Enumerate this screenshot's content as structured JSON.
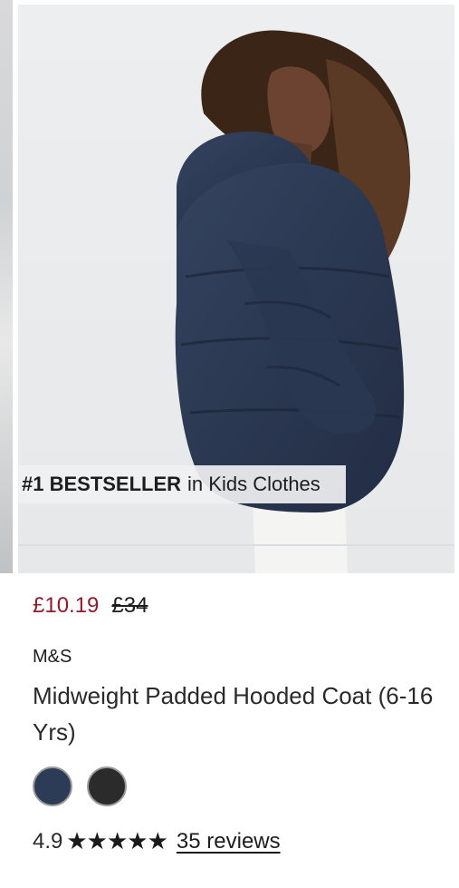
{
  "badge": {
    "rank": "#1 BESTSELLER",
    "category": "in Kids Clothes"
  },
  "price": {
    "current": "£10.19",
    "original": "£34"
  },
  "product": {
    "brand": "M&S",
    "title": "Midweight Padded Hooded Coat (6-16 Yrs)",
    "image_alt": "Girl wearing navy padded hooded coat",
    "colors": [
      {
        "name": "navy",
        "hex": "#2d3c56"
      },
      {
        "name": "black",
        "hex": "#2b2b2b"
      }
    ]
  },
  "rating": {
    "score": "4.9",
    "stars": "★★★★★",
    "reviews": "35 reviews"
  },
  "theme": {
    "sale_price_color": "#8b1e2e",
    "coat_color": "#2c3a55"
  }
}
